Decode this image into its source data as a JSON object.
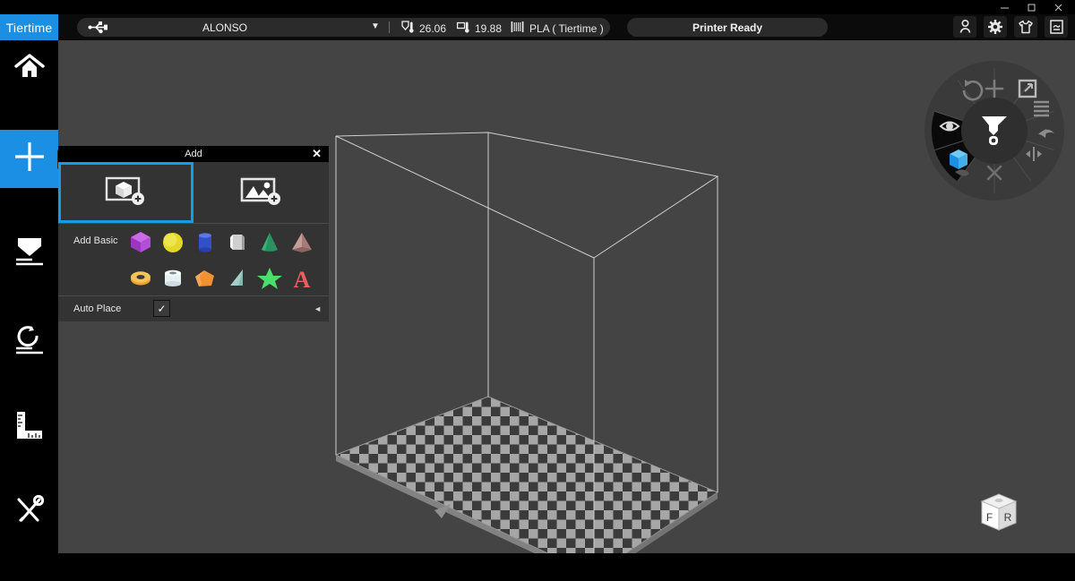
{
  "window": {
    "minimize_label": "minimize",
    "maximize_label": "maximize",
    "close_label": "close"
  },
  "topbar": {
    "brand": "Tiertime",
    "printer_name": "ALONSO",
    "dropdown_caret": "▼",
    "nozzle_temp": "26.06",
    "bed_temp": "19.88",
    "material": "PLA ( Tiertime )",
    "status": "Printer Ready",
    "icons": [
      {
        "name": "user-icon",
        "glyph": "person"
      },
      {
        "name": "gear-icon",
        "glyph": "gear"
      },
      {
        "name": "tshirt-icon",
        "glyph": "tshirt"
      },
      {
        "name": "log-icon",
        "glyph": "document"
      }
    ]
  },
  "sidebar": {
    "items": [
      {
        "name": "home",
        "label": "Home",
        "icon": "home-icon",
        "active": false
      },
      {
        "name": "add",
        "label": "Add",
        "icon": "plus-icon",
        "active": true
      },
      {
        "name": "place",
        "label": "Place",
        "icon": "place-icon",
        "active": false
      },
      {
        "name": "rotate",
        "label": "Rotate",
        "icon": "rotate-icon",
        "active": false
      },
      {
        "name": "measure",
        "label": "Measure",
        "icon": "ruler-icon",
        "active": false
      },
      {
        "name": "maintenance",
        "label": "Maintenance",
        "icon": "tools-icon",
        "active": false
      }
    ]
  },
  "add_panel": {
    "title": "Add",
    "close_label": "✕",
    "tabs": [
      {
        "name": "add-model",
        "icon": "add-model-icon",
        "selected": true
      },
      {
        "name": "add-image",
        "icon": "add-image-icon",
        "selected": false
      }
    ],
    "basic_label": "Add Basic",
    "shapes_row1": [
      {
        "name": "cube",
        "color": "#b84fd8"
      },
      {
        "name": "sphere",
        "color": "#e8e039"
      },
      {
        "name": "cylinder",
        "color": "#3a5ed0"
      },
      {
        "name": "hex-prism",
        "color": "#d6d6d6"
      },
      {
        "name": "cone",
        "color": "#2f9e63"
      },
      {
        "name": "pyramid",
        "color": "#b98a86"
      }
    ],
    "shapes_row2": [
      {
        "name": "torus",
        "color": "#f0b135"
      },
      {
        "name": "tube",
        "color": "#e8f2f4"
      },
      {
        "name": "pentagon-prism",
        "color": "#f09134"
      },
      {
        "name": "wedge",
        "color": "#9fd0c8"
      },
      {
        "name": "star",
        "color": "#4ade6a"
      },
      {
        "name": "text-a",
        "color": "#e8615e"
      }
    ],
    "auto_place": {
      "label": "Auto Place",
      "checked": true,
      "checkmark": "✓",
      "collapse_arrow": "◄"
    }
  },
  "radial_menu": {
    "center_icon": "print-tool-icon",
    "segments": [
      {
        "name": "move",
        "icon": "move-icon",
        "active": false
      },
      {
        "name": "scale",
        "icon": "scale-icon",
        "active": false
      },
      {
        "name": "layers",
        "icon": "layers-icon",
        "active": false
      },
      {
        "name": "undo",
        "icon": "undo-icon",
        "active": false
      },
      {
        "name": "mirror",
        "icon": "mirror-icon",
        "active": false
      },
      {
        "name": "cut",
        "icon": "cut-icon",
        "active": false
      },
      {
        "name": "pan",
        "icon": "pan-icon",
        "active": false
      },
      {
        "name": "model-view",
        "icon": "cube-icon",
        "active": true
      },
      {
        "name": "view-eye",
        "icon": "eye-icon",
        "active": true
      },
      {
        "name": "rotate",
        "icon": "rotate-icon",
        "active": false
      }
    ]
  },
  "view_cube": {
    "front_label": "F",
    "right_label": "R"
  },
  "colors": {
    "accent": "#1a8fe3",
    "panel_bg": "#333333",
    "viewport_bg": "#444444",
    "selection": "#1a9ae0"
  }
}
